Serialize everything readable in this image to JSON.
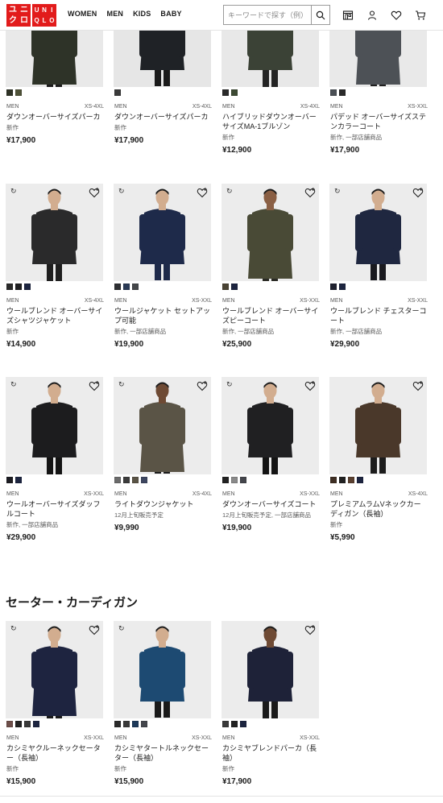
{
  "header": {
    "logo": {
      "left": [
        "ユ",
        "ニ",
        "ク",
        "ロ"
      ],
      "right": [
        "U",
        "N",
        "I",
        "Q",
        "L",
        "O"
      ]
    },
    "nav": [
      "WOMEN",
      "MEN",
      "KIDS",
      "BABY"
    ],
    "search_placeholder": "キーワードで探す（例）",
    "icons": [
      "store-icon",
      "account-icon",
      "heart-icon",
      "cart-icon"
    ]
  },
  "section": {
    "title": "セーター・カーディガン"
  },
  "products": [
    {
      "name": "ダウンオーバーサイズパーカ",
      "gender": "MEN",
      "size": "XS-4XL",
      "note": "新作",
      "price": "¥17,900",
      "tag": "",
      "fav": false,
      "colors": [
        "#2f3326",
        "#4f5238"
      ],
      "img": {
        "bg": "#e9e9e9",
        "coat": "#2e3328",
        "skin": "#c9a486",
        "pants": "#1c1c1c"
      }
    },
    {
      "name": "ダウンオーバーサイズパーカ",
      "gender": "MEN",
      "size": "XS-4XL",
      "note": "新作",
      "price": "¥17,900",
      "tag": "",
      "fav": false,
      "colors": [
        "#3a3a3a"
      ],
      "img": {
        "bg": "#e6e6e6",
        "coat": "#1f2226",
        "skin": "#c9a486",
        "pants": "#1a1a1a"
      }
    },
    {
      "name": "ハイブリッドダウンオーバーサイズMA-1ブルゾン",
      "gender": "MEN",
      "size": "XS-4XL",
      "note": "新作",
      "price": "¥12,900",
      "tag": "",
      "fav": false,
      "colors": [
        "#2a2a2a",
        "#3d4a33"
      ],
      "img": {
        "bg": "#e8e8e8",
        "coat": "#3b4236",
        "skin": "#8a5f44",
        "pants": "#242424"
      }
    },
    {
      "name": "パデッド オーバーサイズステンカラーコート",
      "gender": "MEN",
      "size": "XS-XXL",
      "note": "新作, 一部店舗商品",
      "price": "¥17,900",
      "tag": "",
      "fav": false,
      "colors": [
        "#4a4f55",
        "#2a2a2a"
      ],
      "img": {
        "bg": "#e9e9e9",
        "coat": "#4d5156",
        "skin": "#c9a486",
        "pants": "#202020"
      }
    },
    {
      "name": "ウールブレンド オーバーサイズシャツジャケット",
      "gender": "MEN",
      "size": "XS-4XL",
      "note": "新作",
      "price": "¥14,900",
      "tag": "↻",
      "fav": true,
      "colors": [
        "#2b2b2b",
        "#1f1f22",
        "#1d2540"
      ],
      "img": {
        "bg": "#ececec",
        "coat": "#2a2a2b",
        "skin": "#d2ad8f",
        "pants": "#1f1f1f"
      }
    },
    {
      "name": "ウールジャケット セットアップ可能",
      "gender": "MEN",
      "size": "XS-XXL",
      "note": "新作, 一部店舗商品",
      "price": "¥19,900",
      "tag": "↻",
      "fav": true,
      "colors": [
        "#2e2f33",
        "#2a3a55",
        "#45474a"
      ],
      "img": {
        "bg": "#ececec",
        "coat": "#1e2a4a",
        "skin": "#d2ad8f",
        "pants": "#1e2a4a"
      }
    },
    {
      "name": "ウールブレンド オーバーサイズピーコート",
      "gender": "MEN",
      "size": "XS-XXL",
      "note": "新作, 一部店舗商品",
      "price": "¥25,900",
      "tag": "↻",
      "fav": true,
      "colors": [
        "#4a4434",
        "#1d2540"
      ],
      "img": {
        "bg": "#ececec",
        "coat": "#494a36",
        "skin": "#8a5f44",
        "pants": "#2a2a24"
      }
    },
    {
      "name": "ウールブレンド チェスターコート",
      "gender": "MEN",
      "size": "XS-XXL",
      "note": "新作, 一部店舗商品",
      "price": "¥29,900",
      "tag": "↻",
      "fav": true,
      "colors": [
        "#1f2230",
        "#1d2540"
      ],
      "img": {
        "bg": "#ececec",
        "coat": "#1f2740",
        "skin": "#d2ad8f",
        "pants": "#1a1a1f"
      }
    },
    {
      "name": "ウールオーバーサイズダッフルコート",
      "gender": "MEN",
      "size": "XS-XXL",
      "note": "新作, 一部店舗商品",
      "price": "¥29,900",
      "tag": "↻",
      "fav": true,
      "colors": [
        "#1c1c22",
        "#1d2540"
      ],
      "img": {
        "bg": "#ececec",
        "coat": "#1c1c1e",
        "skin": "#d2ad8f",
        "pants": "#141414"
      }
    },
    {
      "name": "ライトダウンジャケット",
      "gender": "MEN",
      "size": "XS-4XL",
      "note": "12月上旬販売予定",
      "price": "¥9,990",
      "tag": "↻",
      "fav": true,
      "colors": [
        "#6b6b6b",
        "#3c3c3c",
        "#5a5446",
        "#3d4660"
      ],
      "img": {
        "bg": "#ececec",
        "coat": "#5a5446",
        "skin": "#6e4a34",
        "pants": "#1c1c1c"
      }
    },
    {
      "name": "ダウンオーバーサイズコート",
      "gender": "MEN",
      "size": "XS-XXL",
      "note": "12月上旬販売予定, 一部店舗商品",
      "price": "¥19,900",
      "tag": "↻",
      "fav": true,
      "colors": [
        "#222222",
        "#8a8a8a",
        "#44464c"
      ],
      "img": {
        "bg": "#ececec",
        "coat": "#202022",
        "skin": "#d2ad8f",
        "pants": "#141414"
      }
    },
    {
      "name": "プレミアムラムVネックカーディガン（長袖）",
      "gender": "MEN",
      "size": "XS-4XL",
      "note": "新作",
      "price": "¥5,990",
      "tag": "",
      "fav": true,
      "colors": [
        "#3e2e24",
        "#222222",
        "#5a4030",
        "#1d2540"
      ],
      "img": {
        "bg": "#ececec",
        "coat": "#4a382a",
        "skin": "#d2ad8f",
        "pants": "#1c1c1c"
      }
    },
    {
      "name": "カシミヤクルーネックセーター（長袖）",
      "gender": "MEN",
      "size": "XS-XXL",
      "note": "新作",
      "price": "¥15,900",
      "tag": "↻",
      "fav": true,
      "colors": [
        "#6e4f4a",
        "#222222",
        "#3a3a3a",
        "#1d2540"
      ],
      "img": {
        "bg": "#ececec",
        "coat": "#1e2440",
        "skin": "#d2ad8f",
        "pants": "#1a1a1a"
      }
    },
    {
      "name": "カシミヤタートルネックセーター（長袖）",
      "gender": "MEN",
      "size": "XS-XXL",
      "note": "新作",
      "price": "¥15,900",
      "tag": "↻",
      "fav": false,
      "colors": [
        "#2b2b2b",
        "#3a3a3a",
        "#1d3a5a",
        "#44464c"
      ],
      "img": {
        "bg": "#ececec",
        "coat": "#1d4a72",
        "skin": "#d2ad8f",
        "pants": "#1a1a1a"
      }
    },
    {
      "name": "カシミヤブレンドパーカ（長袖）",
      "gender": "MEN",
      "size": "XS-XXL",
      "note": "新作",
      "price": "¥17,900",
      "tag": "",
      "fav": true,
      "colors": [
        "#3a3a3a",
        "#222222",
        "#1d2540"
      ],
      "img": {
        "bg": "#ececec",
        "coat": "#1e2238",
        "skin": "#6e4a34",
        "pants": "#1a1a1a"
      }
    }
  ]
}
